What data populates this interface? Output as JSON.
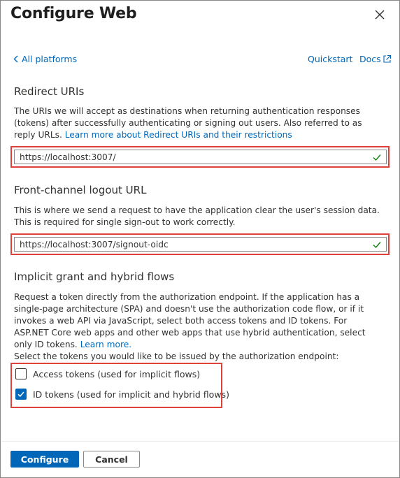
{
  "header": {
    "title": "Configure Web",
    "close_icon": "close-icon"
  },
  "links": {
    "back": "All platforms",
    "quickstart": "Quickstart",
    "docs": "Docs"
  },
  "redirect": {
    "title": "Redirect URIs",
    "description": "The URIs we will accept as destinations when returning authentication responses (tokens) after successfully authenticating or signing out users. Also referred to as reply URLs. ",
    "learn_more": "Learn more about Redirect URIs and their restrictions",
    "value": "https://localhost:3007/"
  },
  "logout": {
    "title": "Front-channel logout URL",
    "description": "This is where we send a request to have the application clear the user's session data. This is required for single sign-out to work correctly.",
    "value": "https://localhost:3007/signout-oidc"
  },
  "implicit": {
    "title": "Implicit grant and hybrid flows",
    "description": "Request a token directly from the authorization endpoint. If the application has a single-page architecture (SPA) and doesn't use the authorization code flow, or if it invokes a web API via JavaScript, select both access tokens and ID tokens. For ASP.NET Core web apps and other web apps that use hybrid authentication, select only ID tokens. ",
    "learn_more": "Learn more.",
    "select_prompt": "Select the tokens you would like to be issued by the authorization endpoint:",
    "tokens": [
      {
        "label": "Access tokens (used for implicit flows)",
        "checked": false
      },
      {
        "label": "ID tokens (used for implicit and hybrid flows)",
        "checked": true
      }
    ]
  },
  "footer": {
    "configure": "Configure",
    "cancel": "Cancel"
  },
  "colors": {
    "accent": "#0067b8",
    "highlight": "#e0403a",
    "valid": "#107c10"
  }
}
